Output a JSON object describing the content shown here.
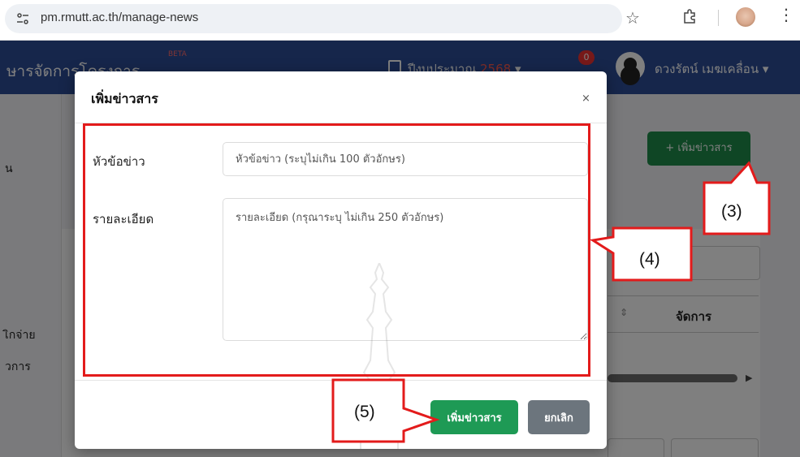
{
  "browser": {
    "url": "pm.rmutt.ac.th/manage-news",
    "site_icon": "tune-icon",
    "star_icon": "star-icon",
    "extensions_icon": "puzzle-icon",
    "menu_icon": "kebab-icon",
    "kebab_glyph": "⋮",
    "star_glyph": "☆"
  },
  "app": {
    "title": "ษารจัดการโครงการ",
    "beta": "BETA",
    "budget_label": "ปีงบประมาณ",
    "budget_year": "2568",
    "budget_caret": "▾",
    "notification_count": "0",
    "user_name": "ดวงรัตน์ เมฆเคลื่อน ▾",
    "left_nav": [
      "น",
      "เิกจ่าย",
      "วการ"
    ],
    "add_news_button": "+ เพิ่มข่าวสาร",
    "table_header_manage": "จัดการ",
    "sort_glyph": "⇕",
    "scroll_arrow": "▶"
  },
  "modal": {
    "title": "เพิ่มข่าวสาร",
    "close_glyph": "×",
    "headline_label": "หัวข้อข่าว",
    "headline_placeholder": "หัวข้อข่าว (ระบุไม่เกิน 100 ตัวอักษร)",
    "detail_label": "รายละเอียด",
    "detail_placeholder": "รายละเอียด (กรุณาระบุ ไม่เกิน 250 ตัวอักษร)",
    "submit_label": "เพิ่มข่าวสาร",
    "cancel_label": "ยกเลิก"
  },
  "annotations": {
    "step3": "(3)",
    "step4": "(4)",
    "step5": "(5)",
    "color": "#e31b1b"
  },
  "colors": {
    "header": "#2d4c96",
    "success": "#1e9a55",
    "secondary": "#6c757d"
  }
}
